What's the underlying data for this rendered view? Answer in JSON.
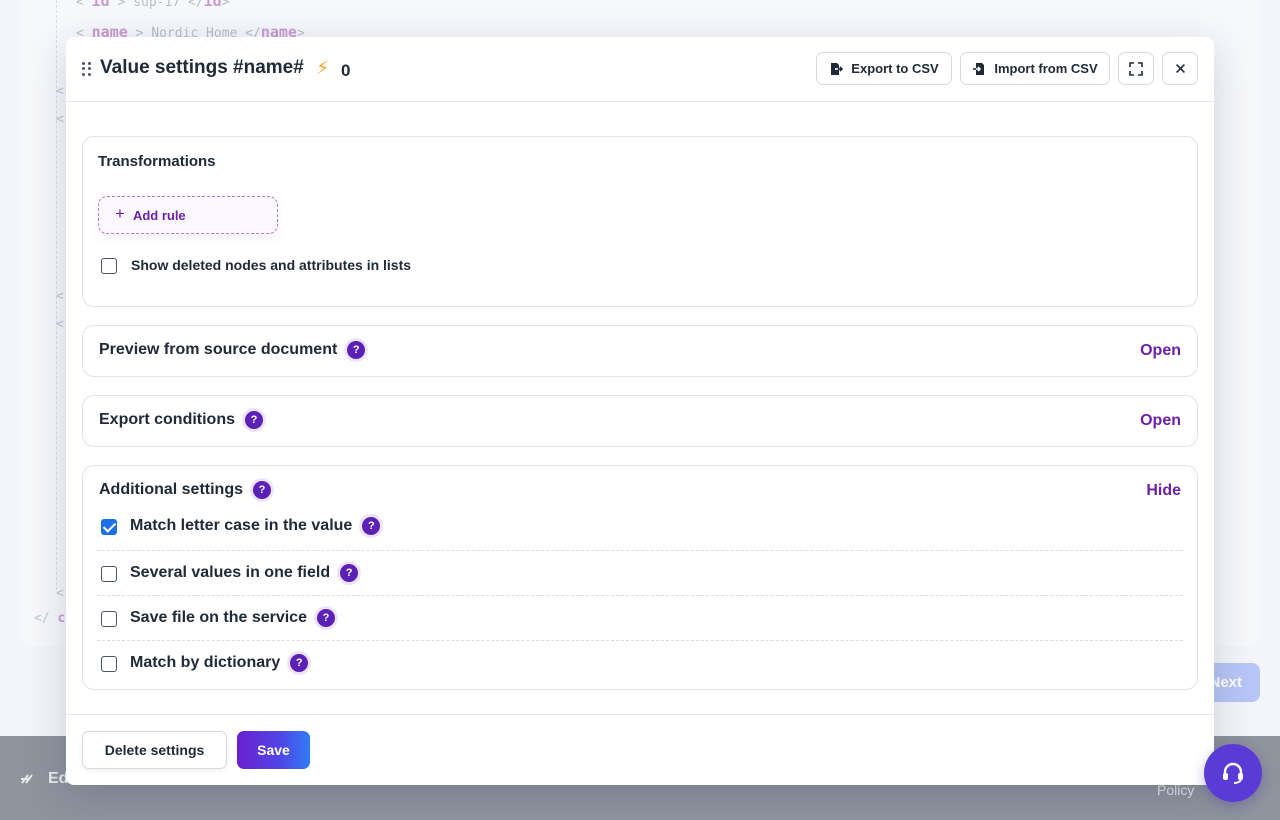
{
  "background": {
    "code_lines": [
      {
        "open_tag": "id",
        "text": "sup-17",
        "close_tag": "id"
      },
      {
        "open_tag": "name",
        "text": "Nordic Home",
        "close_tag": "name"
      }
    ],
    "next_label": "Next",
    "footer_brand": "Ed",
    "footer_policy": "Policy"
  },
  "modal": {
    "title": "Value settings #name#",
    "bolt_icon": "lightning-icon",
    "bolt_count": "0",
    "export_csv_label": "Export to CSV",
    "import_csv_label": "Import from CSV",
    "transformations": {
      "title": "Transformations",
      "add_rule_label": "Add rule",
      "show_deleted_label": "Show deleted nodes and attributes in lists",
      "show_deleted_checked": false
    },
    "preview": {
      "title": "Preview from source document",
      "link": "Open"
    },
    "export_conditions": {
      "title": "Export conditions",
      "link": "Open"
    },
    "additional": {
      "title": "Additional settings",
      "link": "Hide",
      "options": [
        {
          "label": "Match letter case in the value",
          "checked": true
        },
        {
          "label": "Several values in one field",
          "checked": false
        },
        {
          "label": "Save file on the service",
          "checked": false
        },
        {
          "label": "Match by dictionary",
          "checked": false
        }
      ]
    },
    "help_symbol": "?",
    "delete_label": "Delete settings",
    "save_label": "Save"
  },
  "colors": {
    "accent_purple": "#6b21a8",
    "checkbox_blue": "#1d6fe8",
    "save_gradient_start": "#6a1fd1",
    "save_gradient_end": "#2f7cf6"
  }
}
